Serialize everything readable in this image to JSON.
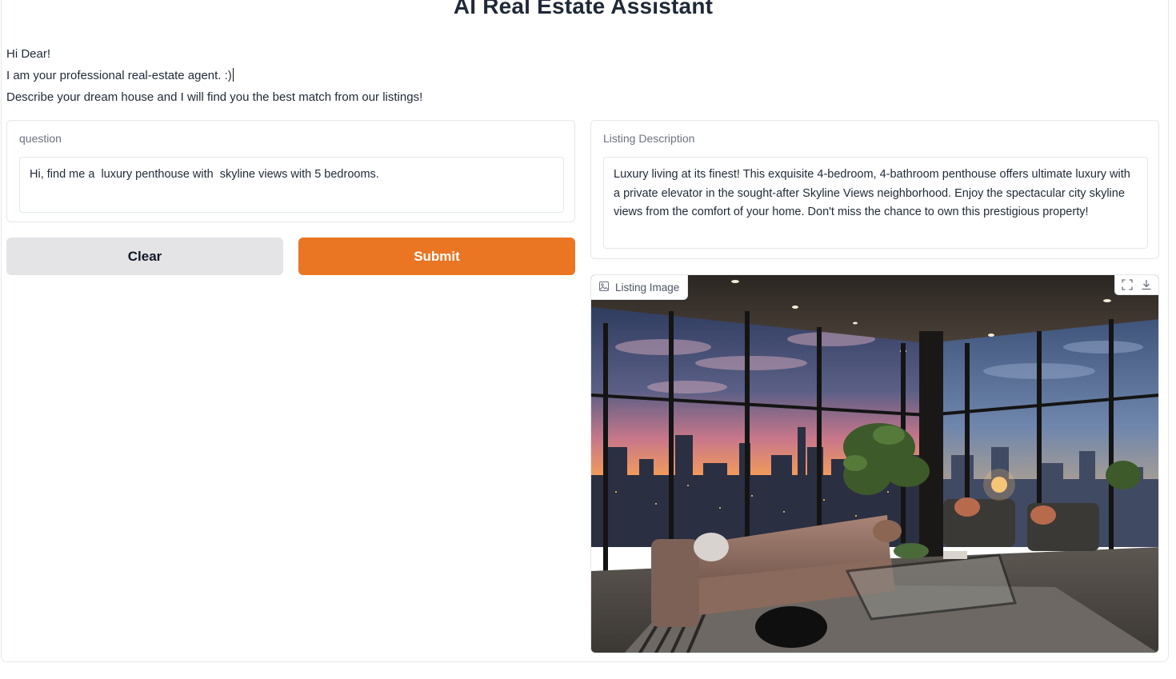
{
  "app": {
    "title": "AI Real Estate Assistant"
  },
  "intro": {
    "line1": "Hi Dear!",
    "line2": "I am your professional real-estate agent. :)",
    "line3": "Describe your dream house and I will find you the best match from our listings!"
  },
  "question": {
    "label": "question",
    "value": "Hi, find me a  luxury penthouse with  skyline views with 5 bedrooms."
  },
  "buttons": {
    "clear_label": "Clear",
    "submit_label": "Submit"
  },
  "listing": {
    "description_label": "Listing Description",
    "description": "Luxury living at its finest! This exquisite 4-bedroom, 4-bathroom penthouse offers ultimate luxury with a private elevator in the sought-after Skyline Views neighborhood. Enjoy the spectacular city skyline views from the comfort of your home. Don't miss the chance to own this prestigious property!",
    "image_label": "Listing Image"
  },
  "icons": {
    "image_label_icon": "image-icon",
    "fullscreen": "fullscreen-icon",
    "download": "download-icon"
  },
  "colors": {
    "accent": "#ea7522",
    "secondary_button": "#e4e4e7"
  }
}
